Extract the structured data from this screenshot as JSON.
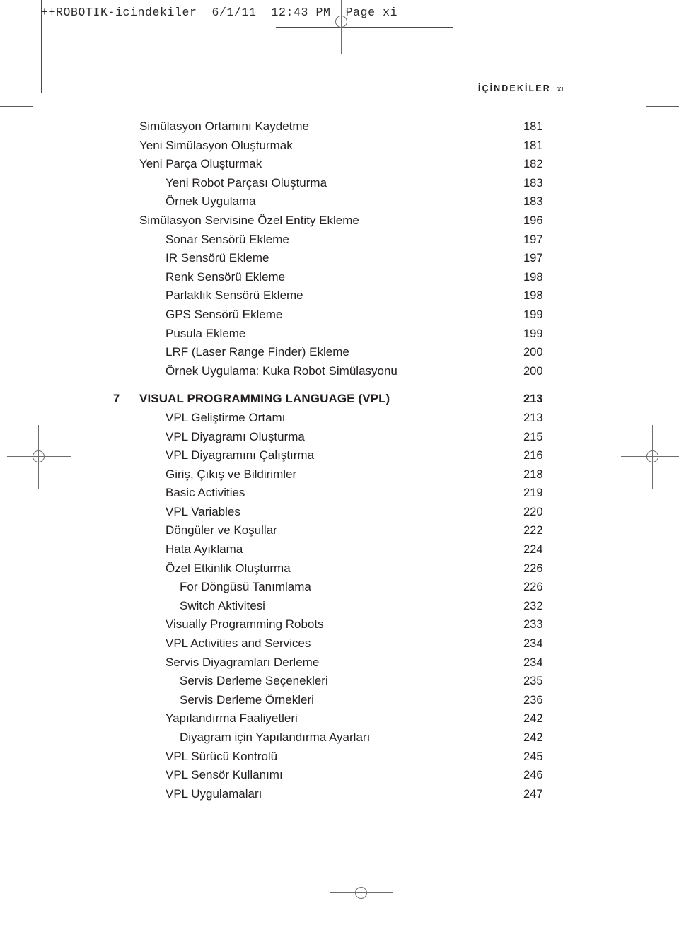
{
  "scan_header": {
    "text": "++ROBOTIK-icindekiler  6/1/11  12:43 PM  Page xi"
  },
  "running_head": {
    "title": "İÇİNDEKİLER",
    "folio": "xi"
  },
  "toc": {
    "rows": [
      {
        "level": 1,
        "num": "",
        "title": "Simülasyon Ortamını Kaydetme",
        "page": "181",
        "chapter": false
      },
      {
        "level": 1,
        "num": "",
        "title": "Yeni Simülasyon Oluşturmak",
        "page": "181",
        "chapter": false
      },
      {
        "level": 1,
        "num": "",
        "title": "Yeni Parça Oluşturmak",
        "page": "182",
        "chapter": false
      },
      {
        "level": 2,
        "num": "",
        "title": "Yeni Robot Parçası Oluşturma",
        "page": "183",
        "chapter": false
      },
      {
        "level": 2,
        "num": "",
        "title": "Örnek Uygulama",
        "page": "183",
        "chapter": false
      },
      {
        "level": 1,
        "num": "",
        "title": "Simülasyon Servisine Özel Entity Ekleme",
        "page": "196",
        "chapter": false
      },
      {
        "level": 2,
        "num": "",
        "title": "Sonar Sensörü Ekleme",
        "page": "197",
        "chapter": false
      },
      {
        "level": 2,
        "num": "",
        "title": "IR Sensörü Ekleme",
        "page": "197",
        "chapter": false
      },
      {
        "level": 2,
        "num": "",
        "title": "Renk Sensörü Ekleme",
        "page": "198",
        "chapter": false
      },
      {
        "level": 2,
        "num": "",
        "title": "Parlaklık Sensörü Ekleme",
        "page": "198",
        "chapter": false
      },
      {
        "level": 2,
        "num": "",
        "title": "GPS Sensörü Ekleme",
        "page": "199",
        "chapter": false
      },
      {
        "level": 2,
        "num": "",
        "title": "Pusula Ekleme",
        "page": "199",
        "chapter": false
      },
      {
        "level": 2,
        "num": "",
        "title": "LRF (Laser Range Finder) Ekleme",
        "page": "200",
        "chapter": false
      },
      {
        "level": 2,
        "num": "",
        "title": "Örnek Uygulama: Kuka Robot Simülasyonu",
        "page": "200",
        "chapter": false
      },
      {
        "level": 1,
        "num": "7",
        "title": "VISUAL PROGRAMMING LANGUAGE (VPL)",
        "page": "213",
        "chapter": true
      },
      {
        "level": 2,
        "num": "",
        "title": "VPL Geliştirme Ortamı",
        "page": "213",
        "chapter": false
      },
      {
        "level": 2,
        "num": "",
        "title": "VPL Diyagramı Oluşturma",
        "page": "215",
        "chapter": false
      },
      {
        "level": 2,
        "num": "",
        "title": "VPL Diyagramını Çalıştırma",
        "page": "216",
        "chapter": false
      },
      {
        "level": 2,
        "num": "",
        "title": "Giriş, Çıkış ve Bildirimler",
        "page": "218",
        "chapter": false
      },
      {
        "level": 2,
        "num": "",
        "title": "Basic Activities",
        "page": "219",
        "chapter": false
      },
      {
        "level": 2,
        "num": "",
        "title": "VPL Variables",
        "page": "220",
        "chapter": false
      },
      {
        "level": 2,
        "num": "",
        "title": "Döngüler ve Koşullar",
        "page": "222",
        "chapter": false
      },
      {
        "level": 2,
        "num": "",
        "title": "Hata Ayıklama",
        "page": "224",
        "chapter": false
      },
      {
        "level": 2,
        "num": "",
        "title": "Özel Etkinlik Oluşturma",
        "page": "226",
        "chapter": false
      },
      {
        "level": 3,
        "num": "",
        "title": "For Döngüsü Tanımlama",
        "page": "226",
        "chapter": false
      },
      {
        "level": 3,
        "num": "",
        "title": "Switch Aktivitesi",
        "page": "232",
        "chapter": false
      },
      {
        "level": 2,
        "num": "",
        "title": "Visually Programming Robots",
        "page": "233",
        "chapter": false
      },
      {
        "level": 2,
        "num": "",
        "title": "VPL Activities and Services",
        "page": "234",
        "chapter": false
      },
      {
        "level": 2,
        "num": "",
        "title": "Servis Diyagramları Derleme",
        "page": "234",
        "chapter": false
      },
      {
        "level": 3,
        "num": "",
        "title": "Servis Derleme Seçenekleri",
        "page": "235",
        "chapter": false
      },
      {
        "level": 3,
        "num": "",
        "title": "Servis Derleme Örnekleri",
        "page": "236",
        "chapter": false
      },
      {
        "level": 2,
        "num": "",
        "title": "Yapılandırma Faaliyetleri",
        "page": "242",
        "chapter": false
      },
      {
        "level": 3,
        "num": "",
        "title": "Diyagram için Yapılandırma Ayarları",
        "page": "242",
        "chapter": false
      },
      {
        "level": 2,
        "num": "",
        "title": "VPL Sürücü Kontrolü",
        "page": "245",
        "chapter": false
      },
      {
        "level": 2,
        "num": "",
        "title": "VPL Sensör Kullanımı",
        "page": "246",
        "chapter": false
      },
      {
        "level": 2,
        "num": "",
        "title": "VPL Uygulamaları",
        "page": "247",
        "chapter": false
      }
    ]
  }
}
